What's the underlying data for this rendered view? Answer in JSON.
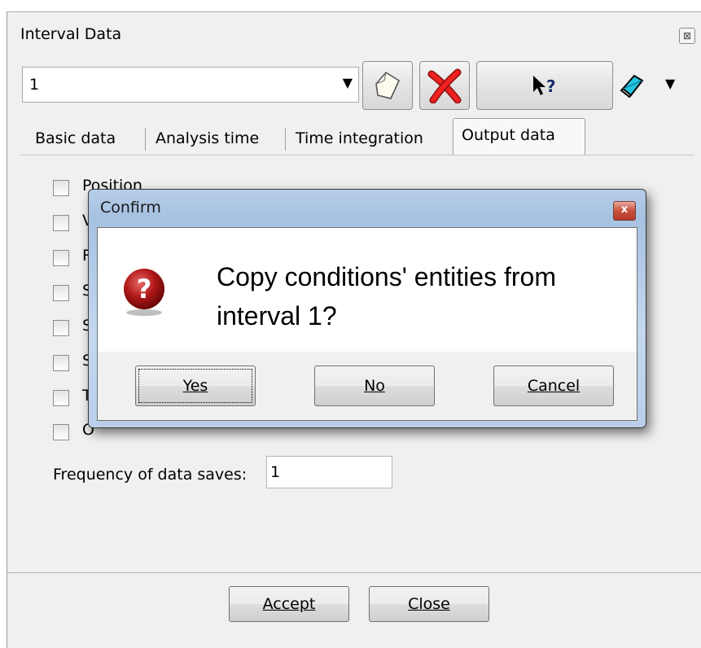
{
  "window": {
    "title": "Interval Data",
    "close_symbol": "⊠"
  },
  "toolbar": {
    "combo_value": "1",
    "buttons": [
      {
        "icon": "new-page-icon"
      },
      {
        "icon": "delete-x-icon",
        "color": "#e02020"
      },
      {
        "icon": "help-pointer-icon",
        "label": "?"
      },
      {
        "icon": "eraser-icon",
        "color": "#20b8d8"
      }
    ]
  },
  "tabs": [
    {
      "label": "Basic data"
    },
    {
      "label": "Analysis time"
    },
    {
      "label": "Time integration"
    },
    {
      "label": "Output data",
      "active": true
    }
  ],
  "output_data": {
    "checkboxes": [
      {
        "label": "Position"
      },
      {
        "label": "V"
      },
      {
        "label": "R"
      },
      {
        "label": "S"
      },
      {
        "label": "S"
      },
      {
        "label": "S"
      },
      {
        "label": "T"
      },
      {
        "label": "O"
      }
    ],
    "frequency_label": "Frequency of data saves:",
    "frequency_value": "1"
  },
  "footer": {
    "accept_label": "Accept",
    "close_label": "Close"
  },
  "dialog": {
    "title": "Confirm",
    "close_symbol": "x",
    "message_line1": "Copy conditions' entities from",
    "message_line2": "interval 1?",
    "icon": "question-icon",
    "icon_color": "#b01818",
    "yes_label": "Yes",
    "no_label": "No",
    "cancel_label": "Cancel"
  }
}
